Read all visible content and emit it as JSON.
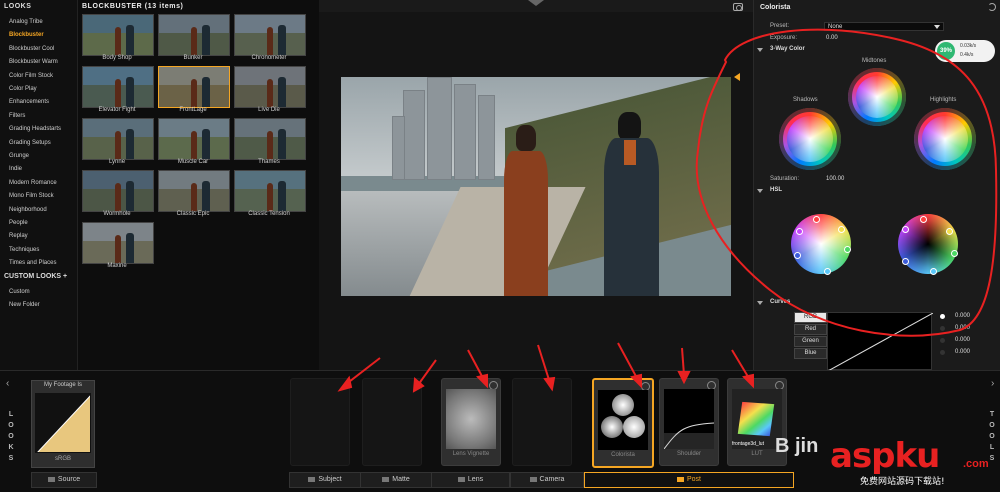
{
  "looks_panel": {
    "header": "LOOKS",
    "categories": [
      {
        "label": "Analog Tribe",
        "active": false
      },
      {
        "label": "Blockbuster",
        "active": true
      },
      {
        "label": "Blockbuster Cool",
        "active": false
      },
      {
        "label": "Blockbuster Warm",
        "active": false
      },
      {
        "label": "Color Film Stock",
        "active": false
      },
      {
        "label": "Color Play",
        "active": false
      },
      {
        "label": "Enhancements",
        "active": false
      },
      {
        "label": "Filters",
        "active": false
      },
      {
        "label": "Grading Headstarts",
        "active": false
      },
      {
        "label": "Grading Setups",
        "active": false
      },
      {
        "label": "Grunge",
        "active": false
      },
      {
        "label": "Indie",
        "active": false
      },
      {
        "label": "Modern Romance",
        "active": false
      },
      {
        "label": "Mono Film Stock",
        "active": false
      },
      {
        "label": "Neighborhood",
        "active": false
      },
      {
        "label": "People",
        "active": false
      },
      {
        "label": "Replay",
        "active": false
      },
      {
        "label": "Techniques",
        "active": false
      },
      {
        "label": "Times and Places",
        "active": false
      }
    ],
    "custom_header": "CUSTOM LOOKS",
    "custom_items": [
      "Custom",
      "New Folder"
    ]
  },
  "grid": {
    "title": "BLOCKBUSTER (13 items)",
    "items": [
      {
        "label": "Body Shop",
        "tint": "#4a6878",
        "ground": "#5d6a4a"
      },
      {
        "label": "Bunker",
        "tint": "#63707a",
        "ground": "#4f5947"
      },
      {
        "label": "Chronometer",
        "tint": "#6c7a86",
        "ground": "#57604e"
      },
      {
        "label": "Elevator Fight",
        "tint": "#4f6f84",
        "ground": "#4a5a50"
      },
      {
        "label": "FrontLage",
        "tint": "#7c7d74",
        "ground": "#6b6247"
      },
      {
        "label": "Live Die",
        "tint": "#6e7379",
        "ground": "#5a5a4a"
      },
      {
        "label": "Lynne",
        "tint": "#5a6e7a",
        "ground": "#58624a"
      },
      {
        "label": "Muscle Car",
        "tint": "#6b7c86",
        "ground": "#5c6a4c"
      },
      {
        "label": "Thames",
        "tint": "#66727a",
        "ground": "#4f5a48"
      },
      {
        "label": "Wormhole",
        "tint": "#4c6070",
        "ground": "#4c5646"
      },
      {
        "label": "Classic Epic",
        "tint": "#727b80",
        "ground": "#5f6050"
      },
      {
        "label": "Classic Tension",
        "tint": "#56717e",
        "ground": "#556250"
      },
      {
        "label": "Maxine",
        "tint": "#7d8489",
        "ground": "#6a6a58"
      }
    ]
  },
  "colorista": {
    "title": "Colorista",
    "preset_label": "Preset:",
    "preset_value": "None",
    "exposure_label": "Exposure:",
    "exposure_value": "0.00",
    "section_3way": "3-Way Color",
    "shadows": "Shadows",
    "midtones": "Midtones",
    "highlights": "Highlights",
    "saturation_label": "Saturation:",
    "saturation_value": "100.00",
    "section_hsl": "HSL",
    "section_curves": "Curves",
    "curve_buttons": [
      "RGB",
      "Red",
      "Green",
      "Blue"
    ],
    "curve_values": [
      "0.000",
      "0.000",
      "0.000",
      "0.000"
    ]
  },
  "network_widget": {
    "cpu": "39%",
    "up": "0.03k/s",
    "down": "0.4k/s"
  },
  "bottom": {
    "looks_side": [
      "L",
      "O",
      "O",
      "K",
      "S"
    ],
    "tools_side": [
      "T",
      "O",
      "O",
      "L",
      "S"
    ],
    "footage_title": "My Footage Is",
    "footage_sub": "sRGB",
    "cards": [
      {
        "label": "",
        "visible": false
      },
      {
        "label": "",
        "visible": false
      },
      {
        "label": "Lens Vignette",
        "visible": true
      },
      {
        "label": "",
        "visible": false
      },
      {
        "label": "Colorista",
        "visible": true,
        "selected": true
      },
      {
        "label": "Shoulder",
        "visible": true
      },
      {
        "label": "LUT",
        "visible": true,
        "overlay": "frontage3d_lut"
      }
    ],
    "tabs": [
      {
        "label": "Source",
        "active": false
      },
      {
        "label": "Subject",
        "active": false
      },
      {
        "label": "Matte",
        "active": false
      },
      {
        "label": "Lens",
        "active": false
      },
      {
        "label": "Camera",
        "active": false
      },
      {
        "label": "Post",
        "active": true
      }
    ]
  },
  "watermark": {
    "brand": "aspku",
    "suffix": ".com",
    "sub": "免费网站源码下载站!",
    "jin": "B jin"
  },
  "colors": {
    "accent": "#f5a623",
    "annotation": "#e82121"
  }
}
